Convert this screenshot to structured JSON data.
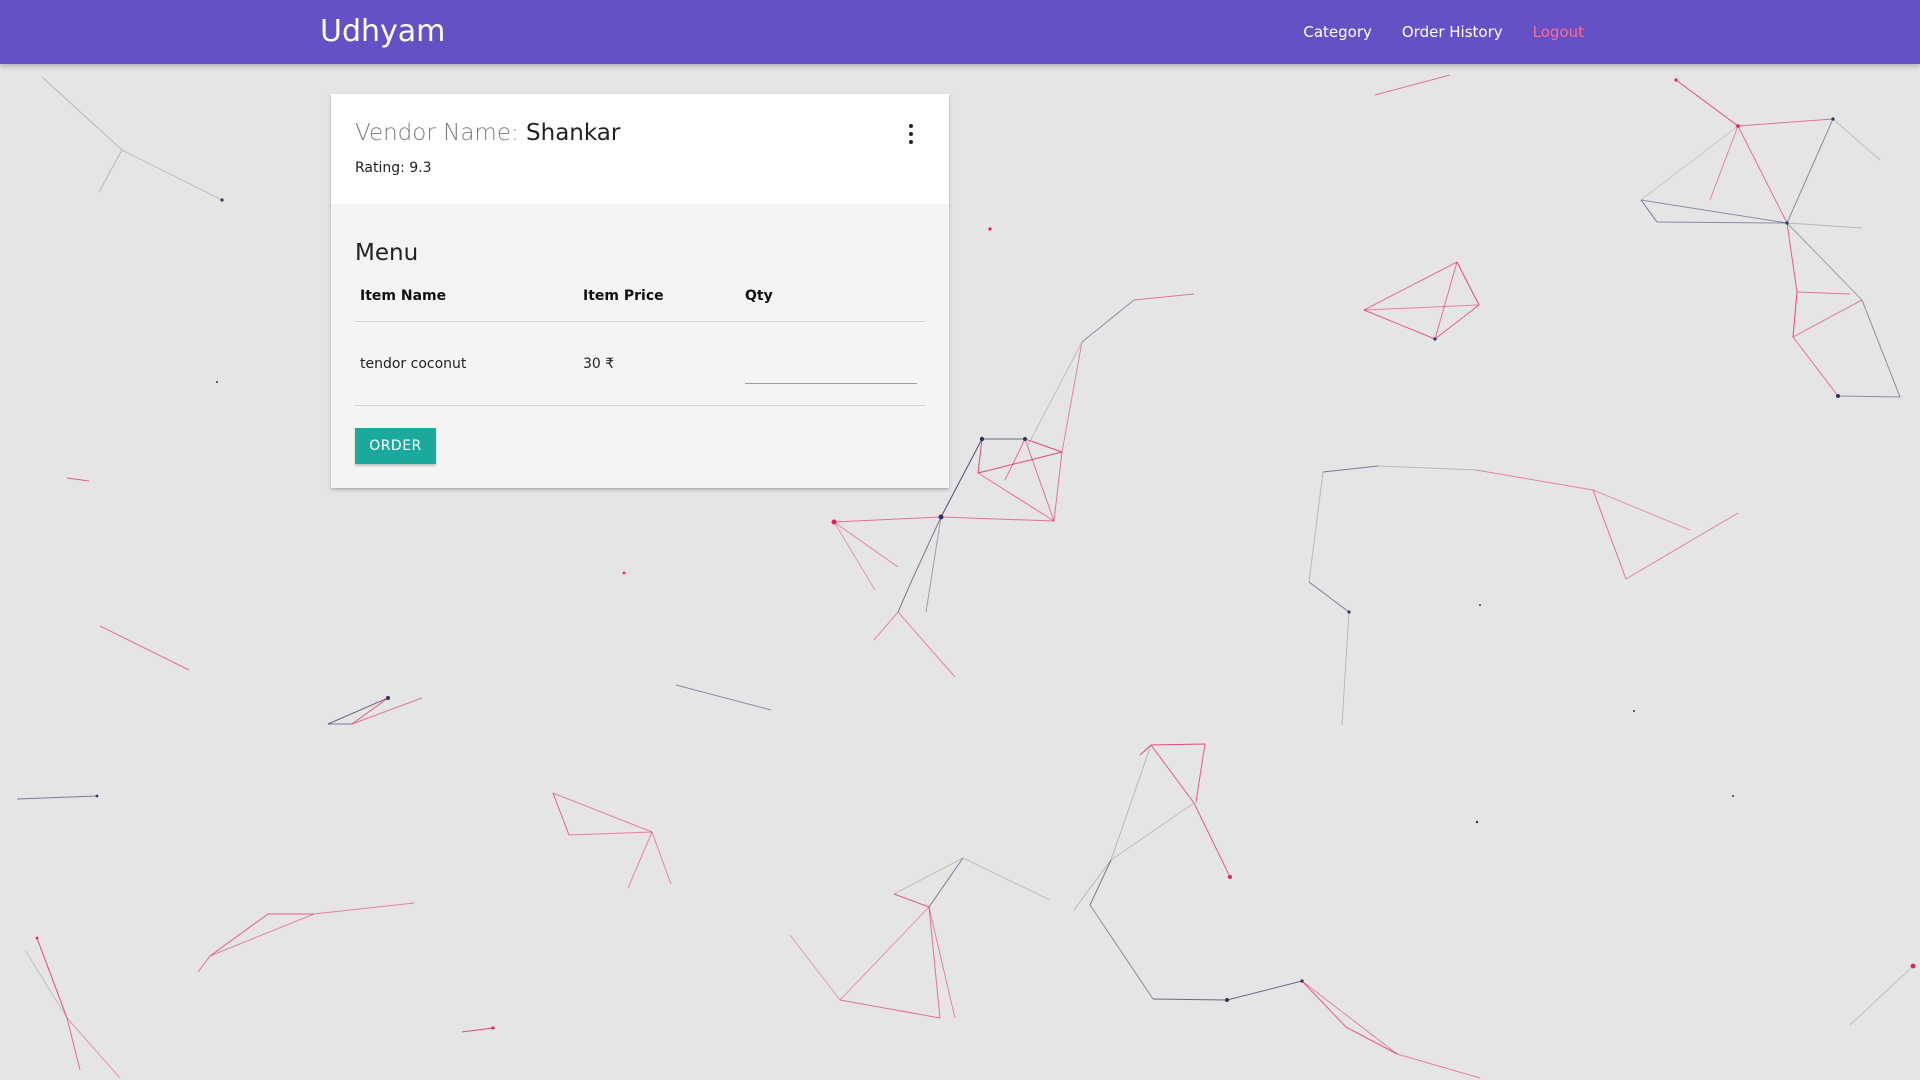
{
  "nav": {
    "brand": "Udhyam",
    "links": [
      "Category",
      "Order History",
      "Logout"
    ]
  },
  "vendor": {
    "label": "Vendor Name:",
    "name": "Shankar",
    "rating": "Rating: 9.3"
  },
  "menu": {
    "title": "Menu",
    "headers": [
      "Item Name",
      "Item Price",
      "Qty"
    ],
    "items": [
      {
        "name": "tendor coconut",
        "price": "30 ₹",
        "qty": ""
      }
    ],
    "order_label": "ORDER"
  },
  "colors": {
    "navbar": "#6650c6",
    "logout": "#ff6b8f",
    "order_button": "#1aa99d",
    "background": "#e5e5e5",
    "particle_pink": "#e91e63",
    "particle_navy": "#2f3560"
  },
  "icons": {
    "card_menu": "more-vertical-icon"
  }
}
